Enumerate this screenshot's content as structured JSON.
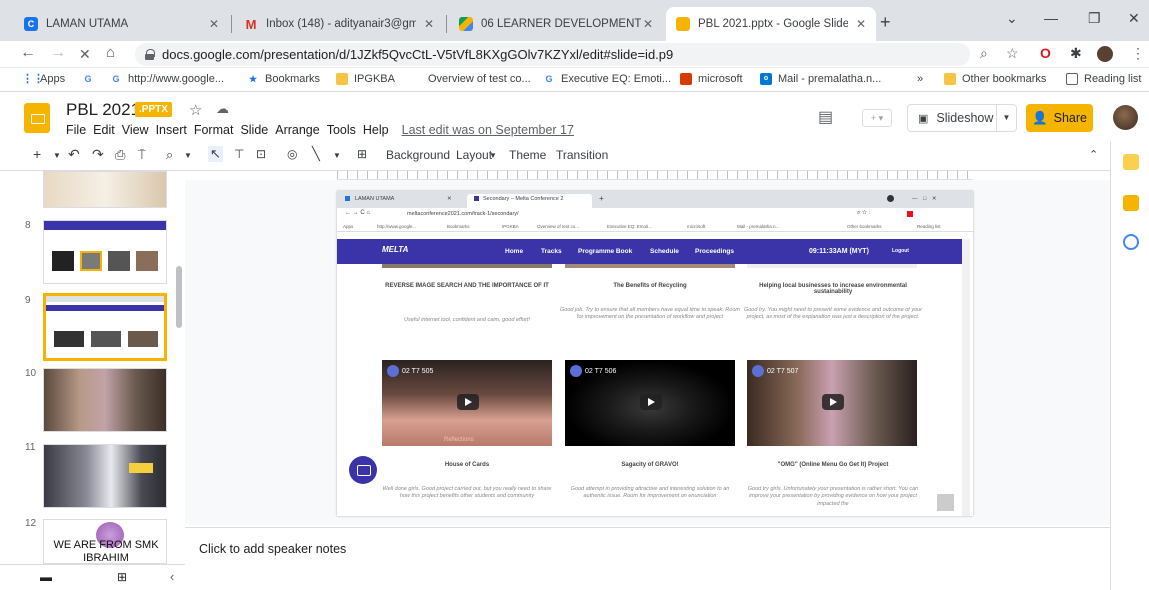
{
  "browser": {
    "tabs": [
      {
        "title": "LAMAN UTAMA",
        "active": false
      },
      {
        "title": "Inbox (148) - adityanair3@gmail",
        "active": false
      },
      {
        "title": "06 LEARNER DEVELOPMENT LAB",
        "active": false
      },
      {
        "title": "PBL 2021.pptx - Google Slides",
        "active": true
      }
    ],
    "url": "docs.google.com/presentation/d/1JZkf5QvcCtL-V5tVfL8KXgGOlv7KZYxl/edit#slide=id.p9",
    "bookmarks": [
      "Apps",
      "http://www.google...",
      "Bookmarks",
      "IPGKBA",
      "Overview of test co...",
      "Executive EQ: Emoti...",
      "microsoft",
      "Mail - premalatha.n..."
    ],
    "bookmarks_more": "»",
    "bookmarks_right": [
      "Other bookmarks",
      "Reading list"
    ]
  },
  "app": {
    "doc_title": "PBL 2021",
    "file_badge": ".PPTX",
    "menu": [
      "File",
      "Edit",
      "View",
      "Insert",
      "Format",
      "Slide",
      "Arrange",
      "Tools",
      "Help"
    ],
    "last_edit": "Last edit was on September 17",
    "slideshow_label": "Slideshow",
    "share_label": "Share",
    "toolbar": {
      "background": "Background",
      "layout": "Layout",
      "theme": "Theme",
      "transition": "Transition"
    }
  },
  "slides_panel": {
    "numbers": [
      "8",
      "9",
      "10",
      "11",
      "12"
    ],
    "slide12_text": "WE ARE FROM SMK IBRAHIM",
    "selected": "9"
  },
  "slide": {
    "inner_tabs": [
      "LAMAN UTAMA",
      "Secondary – Melta Conference 2"
    ],
    "inner_url": "meltaconference2021.com/track-1/secondary/",
    "inner_bookmarks": [
      "Apps",
      "http://www.google...",
      "Bookmarks",
      "IPGKBA",
      "Overview of test co...",
      "Executive EQ: Emoti...",
      "microsoft",
      "Mail - premalatha.n...",
      "Other bookmarks",
      "Reading list"
    ],
    "site": {
      "logo": "MELTA",
      "nav": [
        "Home",
        "Tracks",
        "Programme Book",
        "Schedule",
        "Proceedings"
      ],
      "time": "09:11:33AM (MYT)",
      "logout": "Logout"
    },
    "row1": [
      {
        "title": "REVERSE IMAGE SEARCH AND THE IMPORTANCE OF IT",
        "review": "Useful internet tool, confident and calm, good effort!"
      },
      {
        "title": "The Benefits of Recycling",
        "review": "Good job. Try to ensure that all members have equal time to speak. Room for improvement on the presentation of workflow and project"
      },
      {
        "title": "Helping local businesses to increase environmental sustainability",
        "review": "Good try. You might need to present some evidence and outcome of your project, as most of the explanation was just a description of the project."
      }
    ],
    "videos": [
      {
        "label": "02 T7 505",
        "caption": "Reflections"
      },
      {
        "label": "02 T7 506"
      },
      {
        "label": "02 T7 507"
      }
    ],
    "row2": [
      {
        "title": "House of Cards",
        "review": "Well done girls. Good project carried out, but you really need to share how this project benefits other students and community"
      },
      {
        "title": "Sagacity of GRAVO!",
        "review": "Good attempt in providing attractive and interesting solution to an authentic issue. Room for improvement on enunciation"
      },
      {
        "title": "\"OMG\" (Online Menu Go Get It) Project",
        "review": "Good try girls. Unfortunately your presentation is rather short. You can improve your presentation by providing evidence on how your project impacted the"
      }
    ]
  },
  "notes_placeholder": "Click to add speaker notes",
  "colors": {
    "accent": "#f4b400",
    "melta_nav": "#3a34a8"
  }
}
